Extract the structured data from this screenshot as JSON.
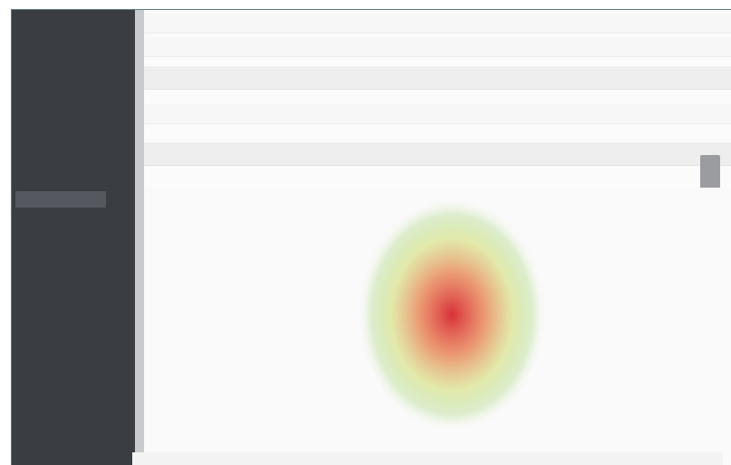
{
  "sidebar": {
    "items": [
      {
        "label": ""
      },
      {
        "label": ""
      },
      {
        "label": ""
      },
      {
        "label": ""
      },
      {
        "label": ""
      },
      {
        "label": ""
      },
      {
        "label": ""
      },
      {
        "label": ""
      },
      {
        "label": ""
      },
      {
        "label": ""
      }
    ]
  },
  "toolbar": {
    "rows": [
      {
        "text": ""
      },
      {
        "text": ""
      },
      {
        "text": ""
      }
    ]
  },
  "filters": {
    "rows": [
      {
        "text": ""
      },
      {
        "text": ""
      }
    ]
  },
  "heatmap": {
    "colors": {
      "hot": "#d9303a",
      "warm": "#e98a5c",
      "mid": "#d8e48a",
      "cool": "#a9d67c",
      "background": "#fafafa"
    }
  },
  "status": {
    "text": ""
  },
  "colors": {
    "sidebar_bg": "#3a3d42",
    "divider": "#c9cacd",
    "frame_border": "#5a7a8c",
    "scroll_handle": "#9a9c9f"
  }
}
